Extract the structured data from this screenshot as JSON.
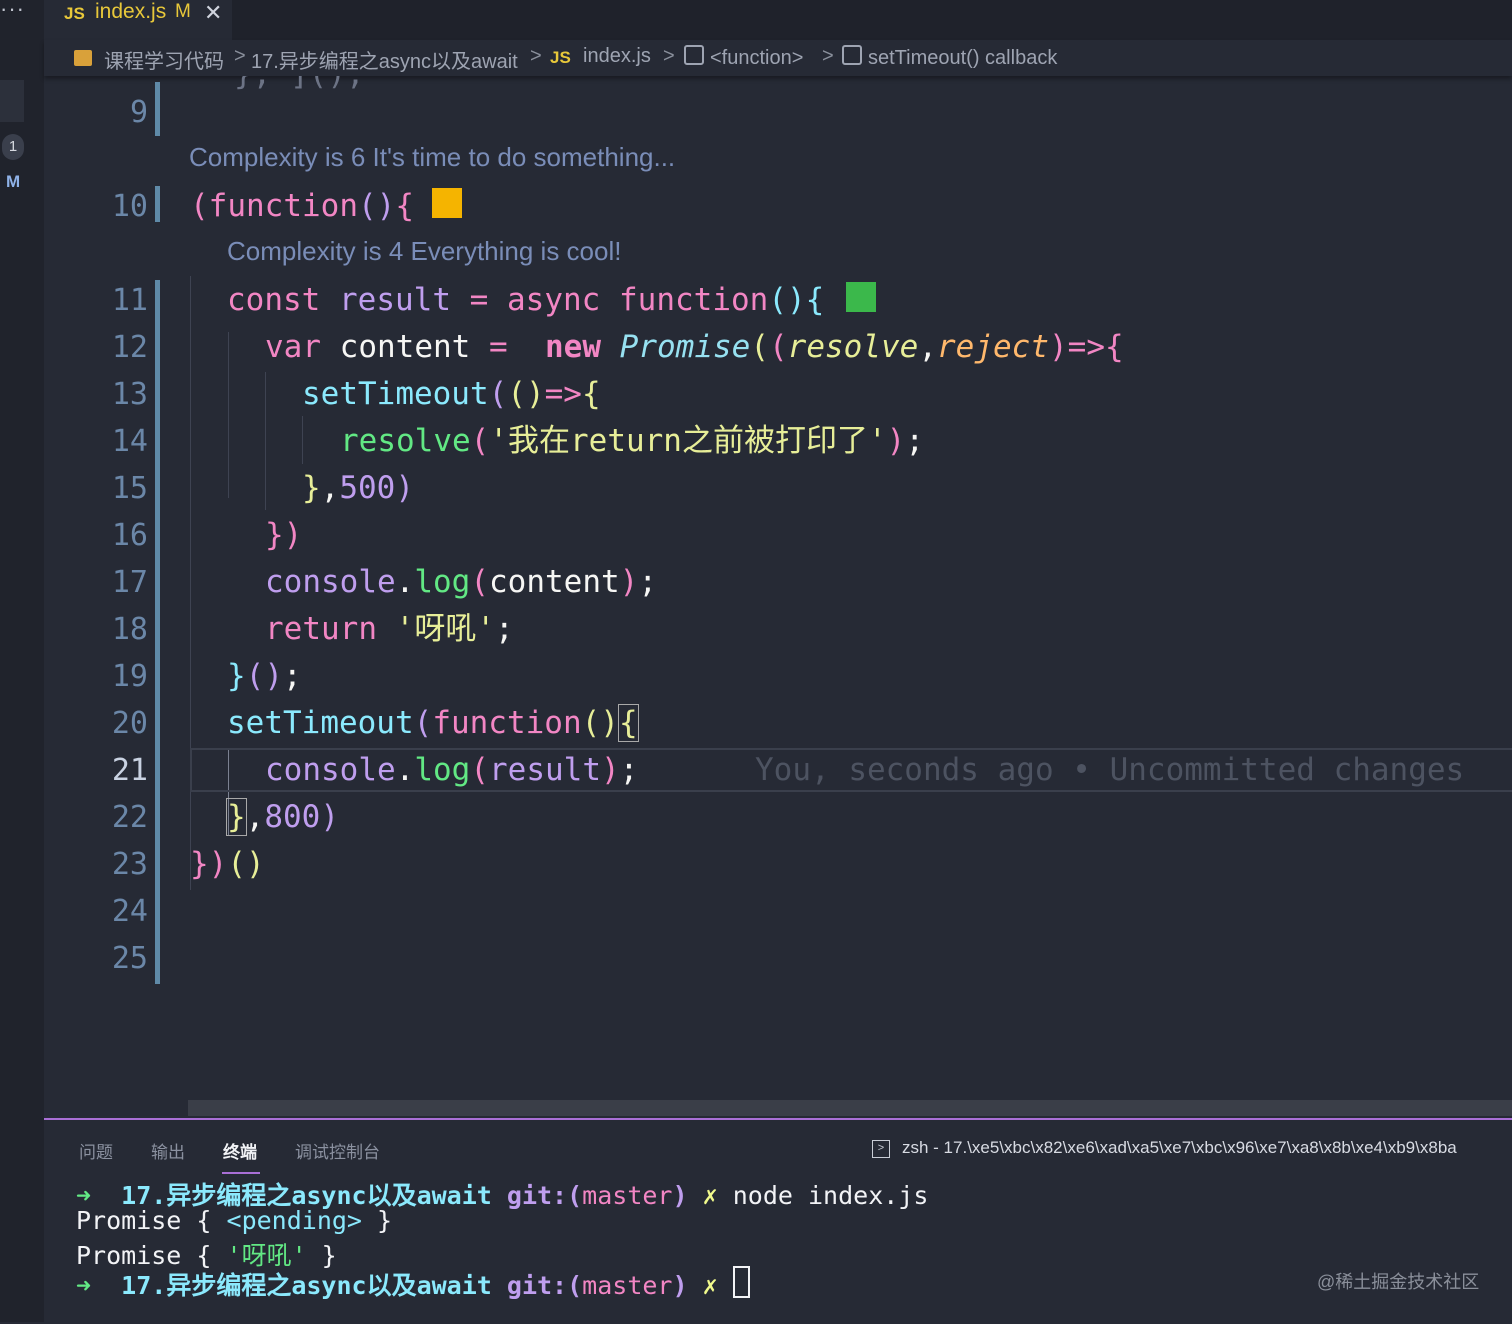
{
  "activity_bar": {
    "menu": "···",
    "badge_count": "1",
    "scm_marker": "M"
  },
  "tab": {
    "lang": "JS",
    "name": "index.js",
    "status": "M",
    "close": "✕"
  },
  "breadcrumb": {
    "folder": "课程学习代码",
    "subfolder": "17.异步编程之async以及await",
    "file_lang": "JS",
    "file": "index.js",
    "sym1": "<function>",
    "sym2": "setTimeout() callback",
    "sep": ">"
  },
  "editor": {
    "line_numbers": [
      "9",
      "10",
      "11",
      "12",
      "13",
      "14",
      "15",
      "16",
      "17",
      "18",
      "19",
      "20",
      "21",
      "22",
      "23",
      "24",
      "25"
    ],
    "lens_outer": "Complexity is 6 It's time to do something...",
    "lens_inner": "Complexity is 4 Everything is cool!",
    "complexity_colors": {
      "outer": "#f5b400",
      "inner": "#3bb84b"
    },
    "blame": "You, seconds ago • Uncommitted changes"
  },
  "panel": {
    "tabs": [
      "问题",
      "输出",
      "终端",
      "调试控制台"
    ],
    "active_tab": "终端",
    "terminal_title": "zsh - 17.\\xe5\\xbc\\x82\\xe6\\xad\\xa5\\xe7\\xbc\\x96\\xe7\\xa8\\x8b\\xe4\\xb9\\x8ba",
    "prompt_arrow": "➜",
    "prompt_dir": "17.异步编程之async以及await",
    "git_label": "git:(",
    "git_branch": "master",
    "git_close": ")",
    "dirty": "✗",
    "command": "node index.js",
    "output": [
      "Promise { <pending> }",
      "Promise { '呀吼' }"
    ],
    "watermark": "@稀土掘金技术社区"
  }
}
